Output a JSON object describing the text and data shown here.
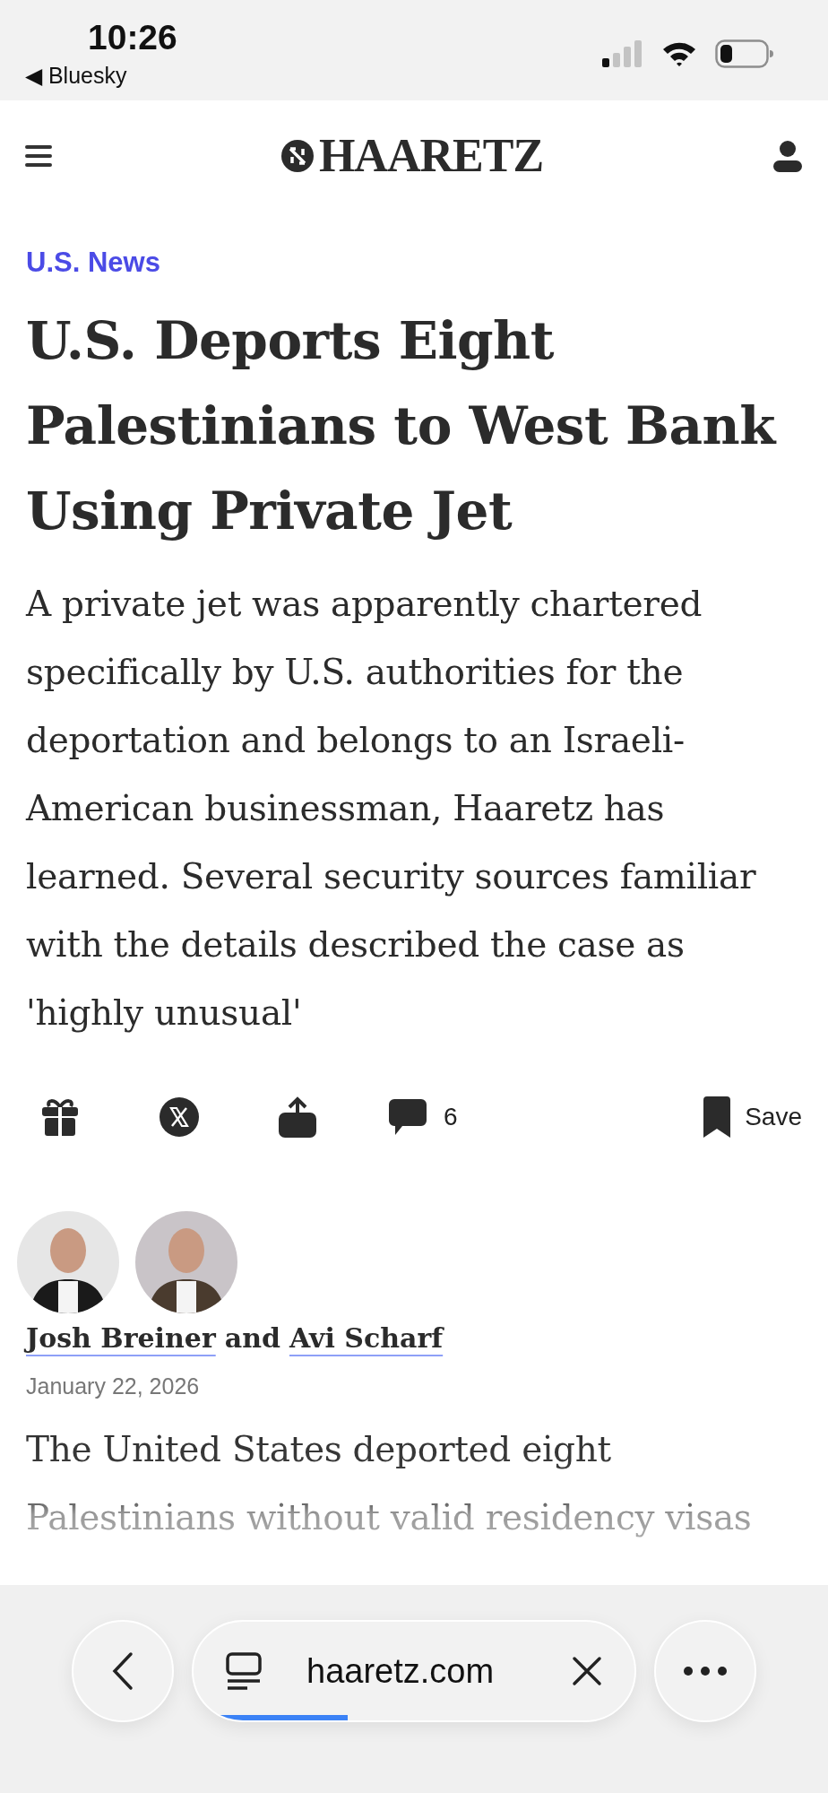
{
  "status_bar": {
    "time": "10:26",
    "back_label": "◀ Bluesky"
  },
  "site_header": {
    "logo_text": "HAARETZ"
  },
  "article": {
    "section": "U.S. News",
    "headline": "U.S. Deports Eight Palestinians to West Bank Using Private Jet",
    "dek": "A private jet was apparently chartered specifically by U.S. authorities for the deportation and belongs to an Israeli-American businessman, Haaretz has learned. Several security sources familiar with the details described the case as 'highly unusual'",
    "actions": [
      {
        "kind": "gift"
      },
      {
        "kind": "x"
      },
      {
        "kind": "share"
      },
      {
        "kind": "comments",
        "label": "6"
      },
      {
        "kind": "save",
        "label": "Save"
      }
    ],
    "authors": [
      {
        "name": "Josh Breiner",
        "kind": "picture"
      },
      {
        "name": "Avi Scharf",
        "kind": "picture"
      }
    ],
    "byline_joiner": "and",
    "date": "January 22, 2026",
    "body_preview": {
      "text": "The United States deported eight Palestinians without valid residency visas",
      "faded": true
    }
  },
  "browser_bar": {
    "url": "haaretz.com",
    "level": 0.35
  }
}
